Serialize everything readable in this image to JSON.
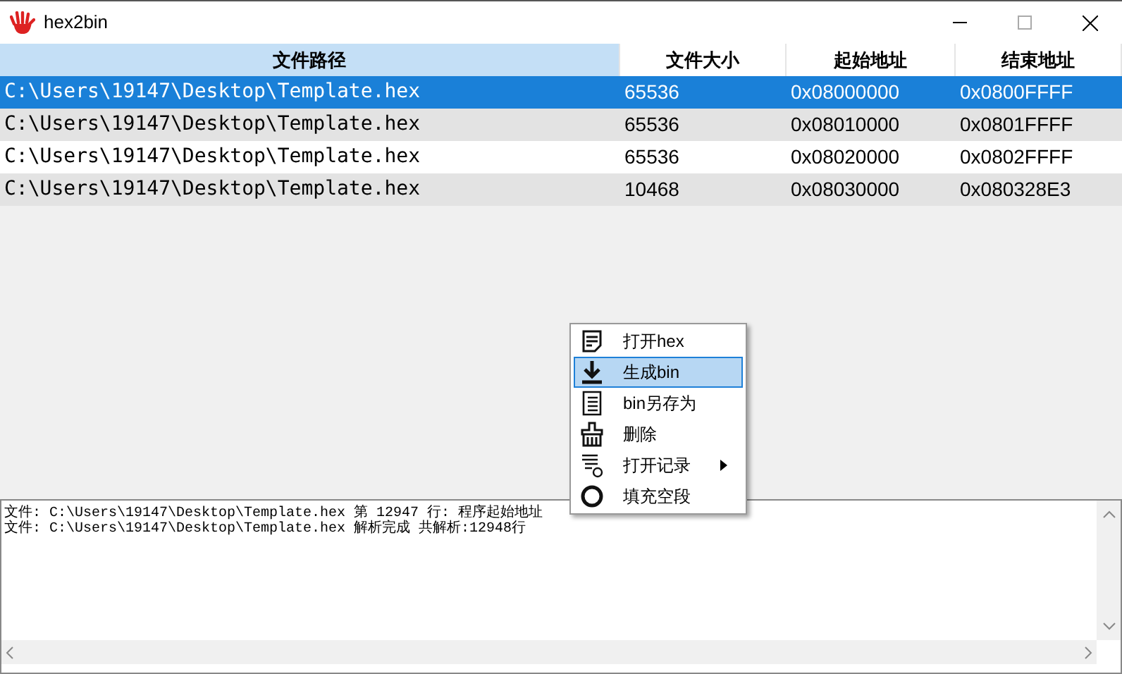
{
  "window": {
    "title": "hex2bin"
  },
  "table": {
    "columns": [
      {
        "label": "文件路径",
        "selected": true
      },
      {
        "label": "文件大小",
        "selected": false
      },
      {
        "label": "起始地址",
        "selected": false
      },
      {
        "label": "结束地址",
        "selected": false
      }
    ],
    "rows": [
      {
        "cells": [
          "C:\\Users\\19147\\Desktop\\Template.hex",
          "65536",
          "0x08000000",
          "0x0800FFFF"
        ],
        "selected": true
      },
      {
        "cells": [
          "C:\\Users\\19147\\Desktop\\Template.hex",
          "65536",
          "0x08010000",
          "0x0801FFFF"
        ],
        "selected": false
      },
      {
        "cells": [
          "C:\\Users\\19147\\Desktop\\Template.hex",
          "65536",
          "0x08020000",
          "0x0802FFFF"
        ],
        "selected": false
      },
      {
        "cells": [
          "C:\\Users\\19147\\Desktop\\Template.hex",
          "10468",
          "0x08030000",
          "0x080328E3"
        ],
        "selected": false
      }
    ]
  },
  "log": [
    "文件: C:\\Users\\19147\\Desktop\\Template.hex 第 12947 行: 程序起始地址",
    "文件: C:\\Users\\19147\\Desktop\\Template.hex 解析完成 共解析:12948行"
  ],
  "context_menu": [
    {
      "label": "打开hex",
      "kind": "note",
      "selected": false,
      "submenu": false
    },
    {
      "label": "生成bin",
      "kind": "download",
      "selected": true,
      "submenu": false
    },
    {
      "label": "bin另存为",
      "kind": "lines",
      "selected": false,
      "submenu": false
    },
    {
      "label": "删除",
      "kind": "brush",
      "selected": false,
      "submenu": false
    },
    {
      "label": "打开记录",
      "kind": "list",
      "selected": false,
      "submenu": true
    },
    {
      "label": "填充空段",
      "kind": "circle",
      "selected": false,
      "submenu": false
    }
  ]
}
